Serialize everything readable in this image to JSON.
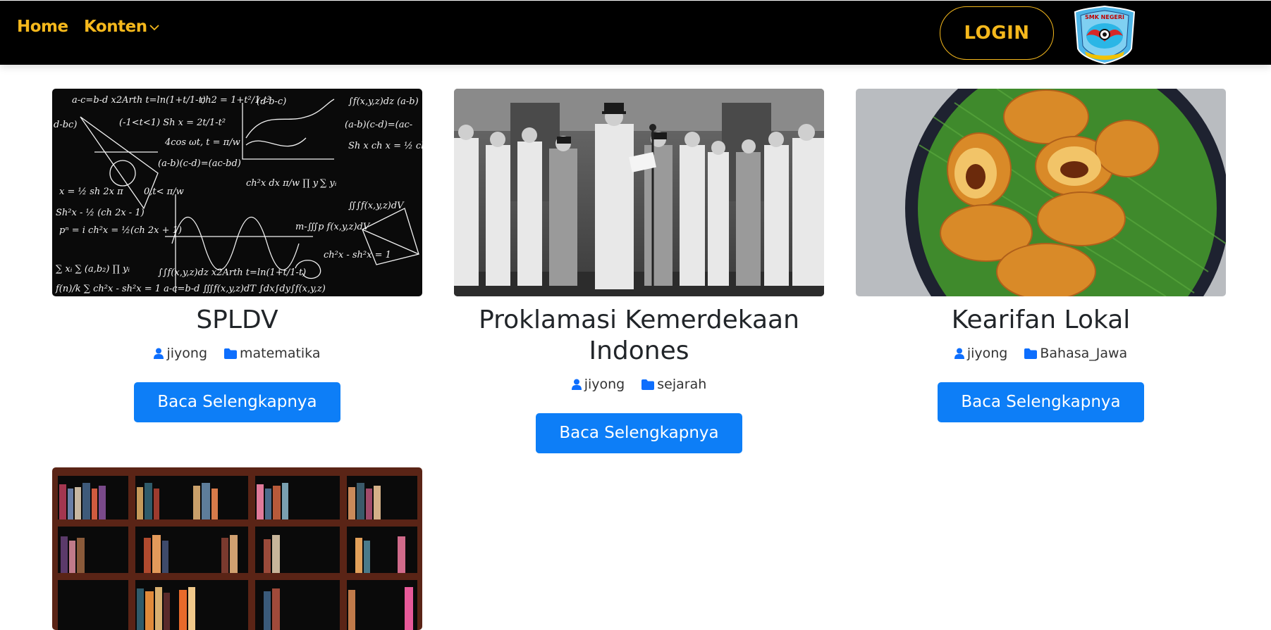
{
  "nav": {
    "home": "Home",
    "konten": "Konten",
    "login": "LOGIN",
    "colors": {
      "bar": "#000000",
      "accent": "#f5b81c"
    }
  },
  "logo": {
    "icon": "school-crest-logo",
    "text": "SMK NEGERI"
  },
  "cards": [
    {
      "title": "SPLDV",
      "author": "jiyong",
      "category": "matematika",
      "button": "Baca Selengkapnya",
      "image": "math-blackboard-image"
    },
    {
      "title": "Proklamasi Kemerdekaan Indones",
      "author": "jiyong",
      "category": "sejarah",
      "button": "Baca Selengkapnya",
      "image": "proclamation-photo-image"
    },
    {
      "title": "Kearifan Lokal",
      "author": "jiyong",
      "category": "Bahasa_Jawa",
      "button": "Baca Selengkapnya",
      "image": "fried-snack-plate-image"
    },
    {
      "title": "",
      "author": "",
      "category": "",
      "button": "",
      "image": "bookshelf-image"
    }
  ],
  "colors": {
    "button": "#0d7ef7",
    "meta_icon": "#0d6efd"
  }
}
